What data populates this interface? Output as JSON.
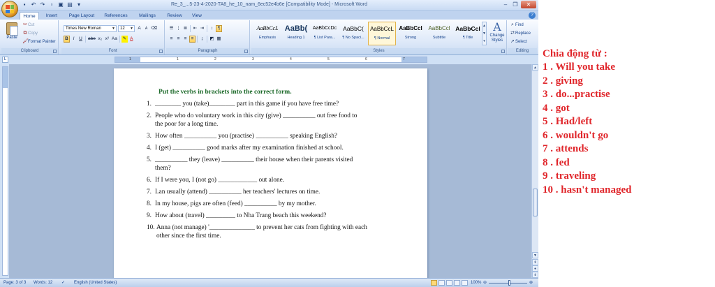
{
  "window": {
    "title": "Re_3_...5-23-4-2020-TA8_he_10_nam_6ec52e4b6e [Compatibility Mode] - Microsoft Word"
  },
  "tabs": [
    "Home",
    "Insert",
    "Page Layout",
    "References",
    "Mailings",
    "Review",
    "View"
  ],
  "active_tab": "Home",
  "ribbon": {
    "clipboard": {
      "label": "Clipboard",
      "paste": "Paste",
      "cut": "Cut",
      "copy": "Copy",
      "format_painter": "Format Painter"
    },
    "font": {
      "label": "Font",
      "font_name": "Times New Roman",
      "font_size": "12",
      "bold": "B",
      "italic": "I",
      "underline": "U",
      "strike": "abe",
      "subscript": "x₂",
      "superscript": "x²",
      "change_case": "Aa",
      "grow": "A",
      "shrink": "A",
      "font_color": "A"
    },
    "paragraph": {
      "label": "Paragraph"
    },
    "styles": {
      "label": "Styles",
      "items": [
        {
          "sample": "AaBbCcL",
          "name": "Emphasis"
        },
        {
          "sample": "AaBb(",
          "name": "Heading 1"
        },
        {
          "sample": "AaBbCcDc",
          "name": "¶ List Para..."
        },
        {
          "sample": "AaBbC(",
          "name": "¶ No Spaci..."
        },
        {
          "sample": "AaBbCcL",
          "name": "¶ Normal"
        },
        {
          "sample": "AaBbCcl",
          "name": "Strong"
        },
        {
          "sample": "AaBbCcl",
          "name": "Subtitle"
        },
        {
          "sample": "AaBbCcl",
          "name": "¶ Title"
        }
      ],
      "active_index": 4,
      "change_styles": "Change Styles"
    },
    "editing": {
      "label": "Editing",
      "find": "Find",
      "replace": "Replace",
      "select": "Select"
    }
  },
  "ruler": {
    "numbers": [
      "1",
      "1",
      "2",
      "3",
      "4",
      "5",
      "6",
      "7"
    ]
  },
  "document": {
    "instruction": "Put the verbs in brackets into the correct form.",
    "questions": [
      {
        "num": "1.",
        "lines": [
          "________ you (take)________ part in this game if you have free time?"
        ]
      },
      {
        "num": "2.",
        "lines": [
          "People who do voluntary work in this city (give) __________ out free food to",
          "the poor for a long time."
        ]
      },
      {
        "num": "3.",
        "lines": [
          "How often __________ you (practise) __________ speaking English?"
        ]
      },
      {
        "num": "4.",
        "lines": [
          "I (get) __________ good marks after my examination finished at school."
        ]
      },
      {
        "num": "5.",
        "lines": [
          "__________ they (leave) __________ their house when their parents visited",
          "them?"
        ]
      },
      {
        "num": "6.",
        "lines": [
          "If I were you, I (not go) ____________ out alone."
        ]
      },
      {
        "num": "7.",
        "lines": [
          "Lan usually (attend) __________ her teachers' lectures on time."
        ]
      },
      {
        "num": "8.",
        "lines": [
          "In my house, pigs are often (feed) __________ by my mother."
        ]
      },
      {
        "num": "9.",
        "lines": [
          "How about (travel) _________ to Nha Trang beach this weekend?"
        ]
      },
      {
        "num": "10.",
        "lines": [
          "Anna (not manage) '______________ to prevent her cats from fighting with each",
          "other since the first time."
        ]
      }
    ]
  },
  "status": {
    "page": "Page: 3 of 3",
    "words": "Words: 12",
    "language": "English (United States)",
    "zoom": "100%"
  },
  "answers": {
    "heading": "Chia động từ :",
    "items": [
      "1 . Will you take",
      "2 . giving",
      "3 . do...practise",
      "4 . got",
      "5 . Had/left",
      "6 . wouldn't go",
      "7 . attends",
      "8 . fed",
      "9 . traveling",
      "10 . hasn't managed"
    ]
  },
  "colors": {
    "instruction_green": "#1d6a2a",
    "answer_red": "#e0262b",
    "ribbon_blue": "#15428b"
  }
}
